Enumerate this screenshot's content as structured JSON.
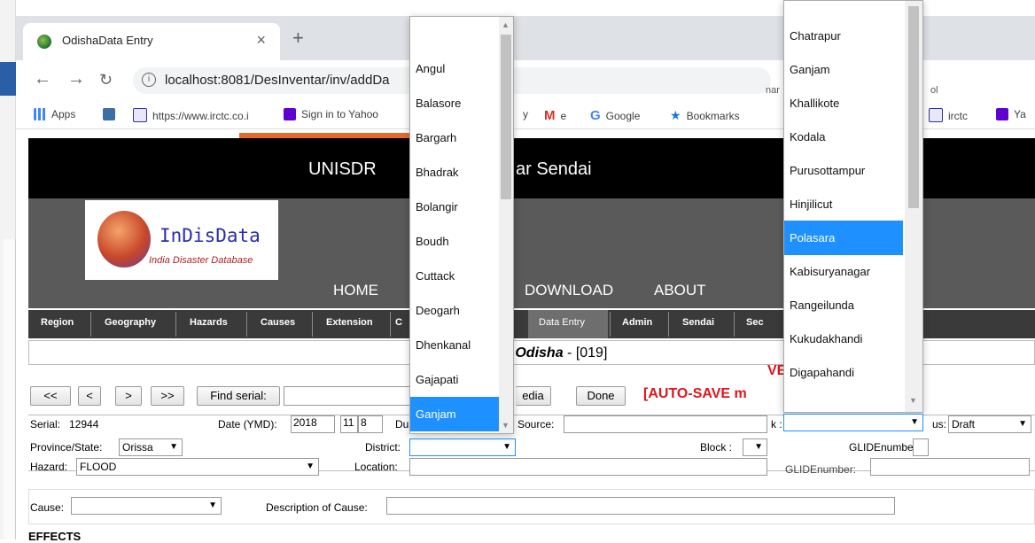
{
  "browser": {
    "tab_title": "OdishaData Entry",
    "tab_close": "×",
    "new_tab": "+",
    "url": "localhost:8081/DesInventar/inv/addDa",
    "bookmarks": [
      "Apps",
      "https://www.irctc.co.i",
      "Sign in to Yahoo",
      "y",
      "e",
      "Google",
      "Bookmarks",
      "irctc",
      "Ya"
    ],
    "url_tail_left": "nar",
    "url_tail_right": "ol"
  },
  "header": {
    "banner_left": "UNISDR",
    "banner_right": "ar Sendai"
  },
  "logo": {
    "name": "InDisData",
    "subtitle": "India Disaster Database"
  },
  "menu": [
    "HOME",
    "DOWNLOAD",
    "ABOUT"
  ],
  "nav": {
    "items": [
      "Region",
      "Geography",
      "Hazards",
      "Causes",
      "Extension",
      "Data Entry",
      "Admin",
      "Sendai",
      "Sec"
    ],
    "partial": "C",
    "active": "Data Entry"
  },
  "title": {
    "prefix": "n",
    "region": "Odisha",
    "code": " - [019]"
  },
  "controls": {
    "first": "<<",
    "prev": "<",
    "next": ">",
    "last": ">>",
    "find": "Find serial:",
    "media": "edia",
    "done": "Done",
    "autosave": "[AUTO-SAVE m",
    "ve": "VE"
  },
  "form": {
    "serial_label": "Serial:",
    "serial": "12944",
    "date_label": "Date (YMD):",
    "year": "2018",
    "month": "11",
    "day": "8",
    "du": "Du",
    "source_label": "Source:",
    "k_label": "k :",
    "status_label": "us:",
    "status": "Draft",
    "province_label": "Province/State:",
    "province": "Orissa",
    "district_label": "District:",
    "block_label": "Block :",
    "glide_label": "GLIDEnumber:",
    "hazard_label": "Hazard:",
    "hazard": "FLOOD",
    "location_label": "Location:",
    "glide_label2": "GLIDEnumber:",
    "cause_label": "Cause:",
    "cause_desc_label": "Description of Cause:",
    "effects": "EFFECTS"
  },
  "district_dropdown": {
    "items": [
      "Angul",
      "Balasore",
      "Bargarh",
      "Bhadrak",
      "Bolangir",
      "Boudh",
      "Cuttack",
      "Deogarh",
      "Dhenkanal",
      "Gajapati",
      "Ganjam"
    ],
    "highlighted": "Ganjam"
  },
  "block_dropdown": {
    "items": [
      "Chatrapur",
      "Ganjam",
      "Khallikote",
      "Kodala",
      "Purusottampur",
      "Hinjilicut",
      "Polasara",
      "Kabisuryanagar",
      "Rangeilunda",
      "Kukudakhandi",
      "Digapahandi"
    ],
    "highlighted": "Polasara"
  },
  "icons": {
    "back": "arrow-left-icon",
    "forward": "arrow-right-icon",
    "reload": "reload-icon",
    "info": "info-icon",
    "dropdown": "chevron-down-icon",
    "scroll_up": "chevron-up-icon",
    "scroll_down": "chevron-down-icon"
  },
  "colors": {
    "highlight": "#1e90ff",
    "autosave": "#e0141b",
    "navbar": "#3a3a3a",
    "banner": "#000000"
  }
}
